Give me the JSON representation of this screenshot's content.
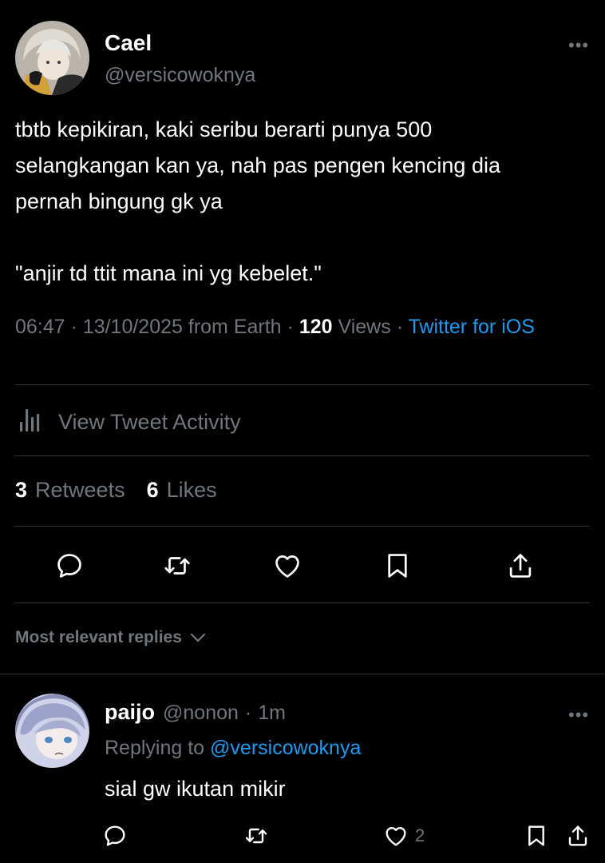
{
  "tweet": {
    "author_name": "Cael",
    "author_handle": "@versicowoknya",
    "more_glyph": "•••",
    "text_lines": [
      "tbtb kepikiran, kaki seribu berarti punya 500",
      "selangkangan kan ya, nah pas pengen kencing dia",
      "pernah bingung gk ya"
    ],
    "quote_line": "\"anjir td ttit mana ini yg kebelet.\"",
    "time": "06:47",
    "date": "13/10/2025",
    "location": "from Earth",
    "views_count": "120",
    "views_label": "Views",
    "client": "Twitter for iOS",
    "separator": "·"
  },
  "activity": {
    "label": "View Tweet Activity",
    "icon": "chart-bars-icon"
  },
  "stats": {
    "retweets_count": "3",
    "retweets_label": "Retweets",
    "likes_count": "6",
    "likes_label": "Likes"
  },
  "actions": [
    "reply-icon",
    "retweet-icon",
    "like-icon",
    "bookmark-icon",
    "share-icon"
  ],
  "replies_filter": {
    "label": "Most relevant replies"
  },
  "reply": {
    "author_name": "paijo",
    "author_handle": "@nonon",
    "time": "1m",
    "replying_prefix": "Replying to",
    "replying_handle": "@versicowoknya",
    "text": "sial gw ikutan mikir",
    "like_count": "2",
    "more_glyph": "•••"
  },
  "colors": {
    "background": "#000000",
    "text": "#ffffff",
    "muted": "#71767b",
    "link": "#1d9bf0",
    "divider": "#2f3336"
  }
}
